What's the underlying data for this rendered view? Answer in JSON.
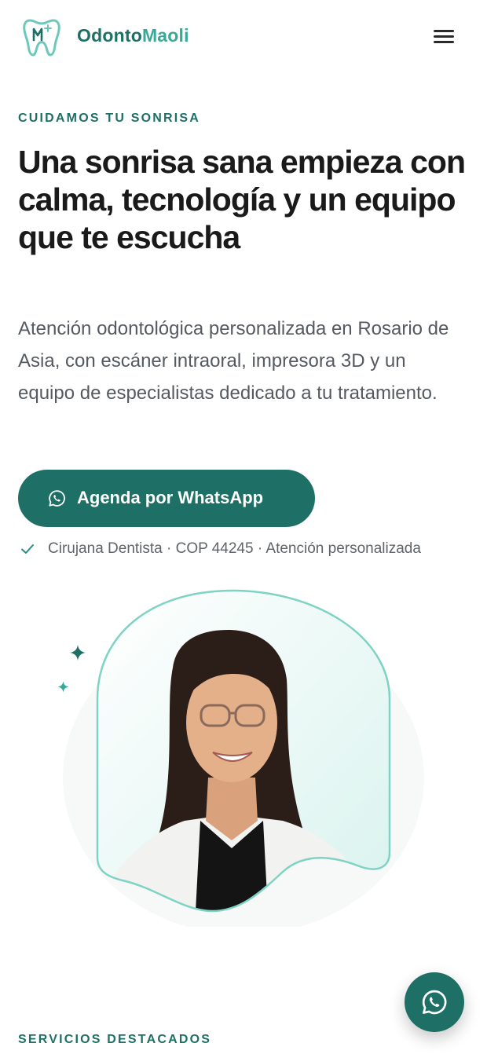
{
  "header": {
    "brand_part1": "Odonto",
    "brand_part2": "Maoli",
    "logo_icon": "tooth-logo-icon",
    "menu_icon": "hamburger-menu-icon"
  },
  "hero": {
    "eyebrow": "CUIDAMOS TU SONRISA",
    "title": "Una sonrisa sana empieza con calma, tecnología y un equipo que te escucha",
    "description": "Atención odontológica personalizada en Rosario de Asia, con escáner intraoral, impresora 3D y un equipo de especialistas dedicado a tu tratamiento.",
    "cta_label": "Agenda por WhatsApp",
    "cta_icon": "whatsapp-icon",
    "credential": "Cirujana Dentista · COP 44245 · Atención personalizada",
    "credential_icon": "check-icon"
  },
  "services": {
    "eyebrow": "SERVICIOS DESTACADOS"
  },
  "fab": {
    "icon": "whatsapp-icon"
  },
  "colors": {
    "primary": "#1e6f66",
    "accent": "#3aa898",
    "mint": "#7fd3c4",
    "text": "#1a1a1a",
    "muted": "#555a60"
  }
}
